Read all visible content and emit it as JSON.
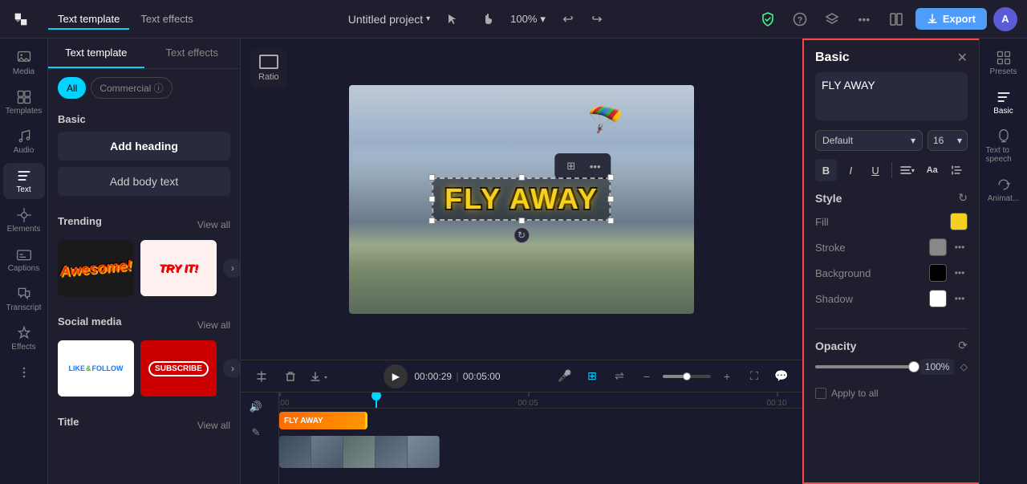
{
  "topbar": {
    "logo": "✦",
    "project_title": "Untitled project",
    "chevron": "▾",
    "zoom": "100%",
    "export_label": "Export",
    "avatar_initials": "A",
    "undo_icon": "↩",
    "redo_icon": "↪",
    "more_label": "•••"
  },
  "tabs": {
    "text_template": "Text template",
    "text_effects": "Text effects"
  },
  "left_panel": {
    "filter_all": "All",
    "filter_commercial": "Commercial ⓘ",
    "basic_title": "Basic",
    "add_heading": "Add heading",
    "add_body": "Add body text",
    "trending_title": "Trending",
    "view_all_1": "View all",
    "social_title": "Social media",
    "view_all_2": "View all",
    "title_section": "Title",
    "view_all_3": "View all"
  },
  "sidebar_items": [
    {
      "id": "media",
      "label": "Media"
    },
    {
      "id": "templates",
      "label": "Templates"
    },
    {
      "id": "audio",
      "label": "Audio"
    },
    {
      "id": "text",
      "label": "Text",
      "active": true
    },
    {
      "id": "elements",
      "label": "Elements"
    },
    {
      "id": "captions",
      "label": "Captions"
    },
    {
      "id": "transcript",
      "label": "Transcript"
    },
    {
      "id": "effects",
      "label": "Effects"
    }
  ],
  "canvas": {
    "text": "FLY AWAY",
    "rotate_icon": "↻"
  },
  "ratio": {
    "label": "Ratio"
  },
  "timeline": {
    "play_icon": "▶",
    "current_time": "00:00:29",
    "separator": "|",
    "total_time": "00:05:00",
    "clip_label": "FLY AWAY"
  },
  "right_panel": {
    "title": "Basic",
    "close": "✕",
    "text_value": "FLY AWAY",
    "font_default": "Default",
    "font_size": "16",
    "bold": "B",
    "italic": "I",
    "underline": "U",
    "style_title": "Style",
    "fill_label": "Fill",
    "fill_color": "#f5d020",
    "stroke_label": "Stroke",
    "stroke_color": "#888888",
    "background_label": "Background",
    "background_color": "#000000",
    "shadow_label": "Shadow",
    "shadow_color": "#ffffff",
    "opacity_title": "Opacity",
    "opacity_value": "100%",
    "apply_all": "Apply to all"
  },
  "far_right": {
    "presets": "Presets",
    "basic": "Basic",
    "tts": "Text to speech",
    "animate": "Animat..."
  }
}
